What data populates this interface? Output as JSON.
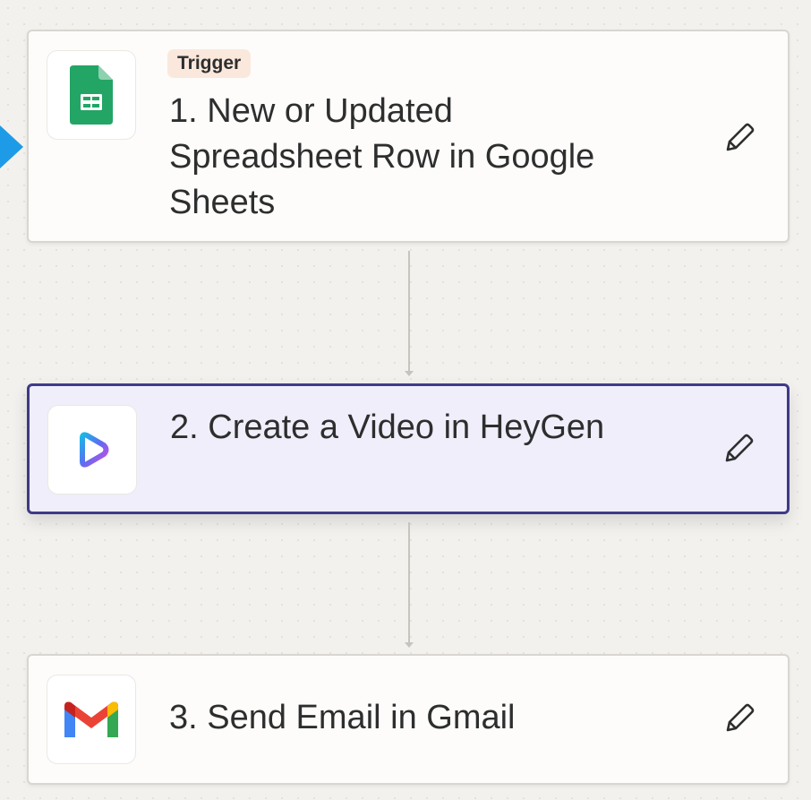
{
  "steps": [
    {
      "number": "1",
      "badge": "Trigger",
      "title": "1. New or Updated Spreadsheet Row in Google Sheets",
      "app_icon": "google-sheets-icon",
      "edit_icon": "pencil-icon",
      "selected": false
    },
    {
      "number": "2",
      "title": "2. Create a Video in HeyGen",
      "app_icon": "heygen-icon",
      "edit_icon": "pencil-icon",
      "selected": true
    },
    {
      "number": "3",
      "title": "3. Send Email in Gmail",
      "app_icon": "gmail-icon",
      "edit_icon": "pencil-icon",
      "selected": false
    }
  ],
  "colors": {
    "canvas_background": "#f3f1ee",
    "card_background": "#fdfcfa",
    "selected_card_background": "#efeefa",
    "selected_card_border": "#3e3a87",
    "trigger_badge_background": "#fbe8dd",
    "selection_arrow": "#1e9be6",
    "connector": "#c7c3bd",
    "text": "#2d2e2e"
  }
}
